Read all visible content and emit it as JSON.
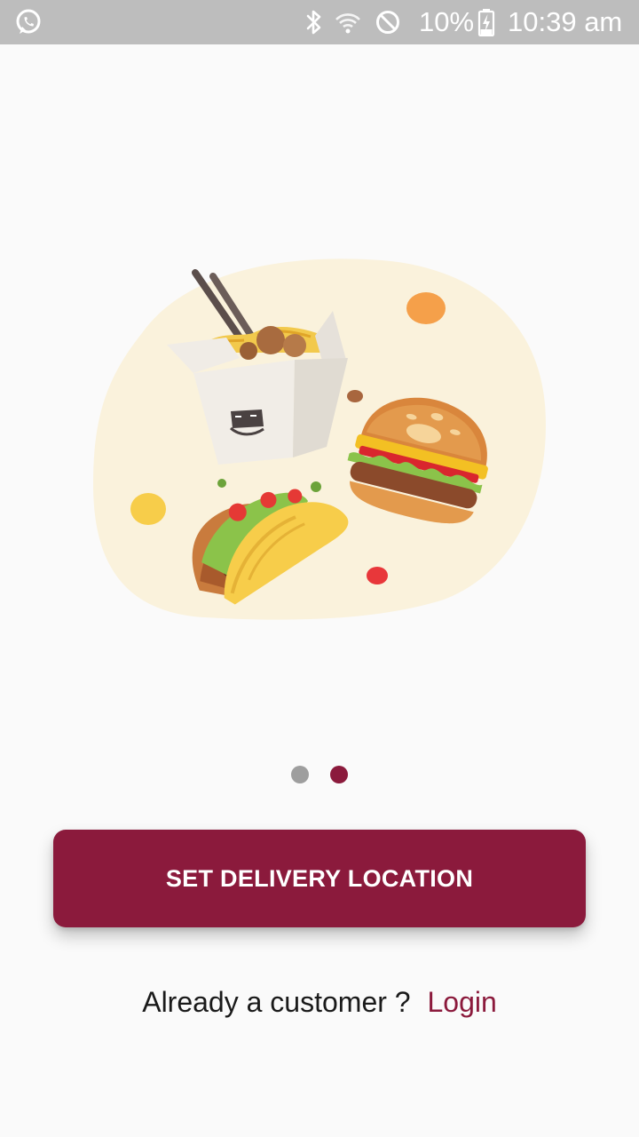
{
  "status_bar": {
    "notification_icons": [
      "whatsapp-icon"
    ],
    "system_icons": [
      "bluetooth-icon",
      "wifi-icon",
      "do-not-disturb-icon",
      "battery-charging-icon"
    ],
    "battery_percent": "10%",
    "time": "10:39 am"
  },
  "onboarding": {
    "illustration": "food-illustration",
    "pager": {
      "page_count": 2,
      "active_index": 1
    }
  },
  "actions": {
    "primary_button_label": "SET DELIVERY LOCATION",
    "login_prompt": "Already a customer ?",
    "login_link": "Login"
  },
  "colors": {
    "accent": "#8b1a3c",
    "status_bar_bg": "#bdbdbd",
    "background": "#fafafa",
    "inactive_dot": "#9e9e9e"
  }
}
